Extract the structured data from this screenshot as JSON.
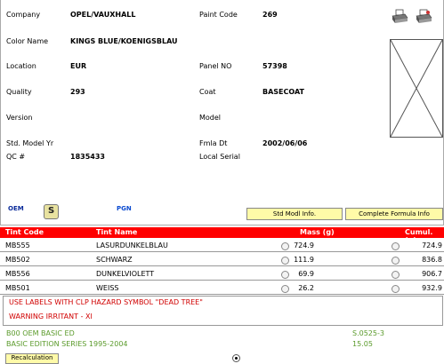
{
  "details": {
    "company_label": "Company",
    "company_value": "OPEL/VAUXHALL",
    "color_name_label": "Color Name",
    "color_name_value": "KINGS BLUE/KOENIGSBLAU",
    "location_label": "Location",
    "location_value": "EUR",
    "quality_label": "Quality",
    "quality_value": "293",
    "version_label": "Version",
    "version_value": "",
    "std_model_yr_label": "Std. Model Yr",
    "std_model_yr_value": "",
    "qc_label": "QC #",
    "qc_value": "1835433",
    "paint_code_label": "Paint Code",
    "paint_code_value": "269",
    "panel_no_label": "Panel NO",
    "panel_no_value": "57398",
    "coat_label": "Coat",
    "coat_value": "BASECOAT",
    "model_label": "Model",
    "model_value": "",
    "fmla_dt_label": "Fmla Dt",
    "fmla_dt_value": "2002/06/06",
    "local_serial_label": "Local Serial",
    "local_serial_value": ""
  },
  "icons": {
    "oem": "OEM",
    "s": "S",
    "pgn": "PGN"
  },
  "buttons": {
    "std_modl_info": "Std Modl Info.",
    "complete_formula_info": "Complete Formula Info",
    "recalculation": "Recalculation"
  },
  "table": {
    "headers": {
      "tint_code": "Tint Code",
      "tint_name": "Tint Name",
      "mass": "Mass (g)",
      "cumul": "Cumul. (g)"
    },
    "rows": [
      {
        "code": "MB555",
        "name": "LASURDUNKELBLAU",
        "mass": "724.9",
        "cumul": "724.9"
      },
      {
        "code": "MB502",
        "name": "SCHWARZ",
        "mass": "111.9",
        "cumul": "836.8"
      },
      {
        "code": "MB556",
        "name": "DUNKELVIOLETT",
        "mass": "69.9",
        "cumul": "906.7"
      },
      {
        "code": "MB501",
        "name": "WEISS",
        "mass": "26.2",
        "cumul": "932.9"
      }
    ]
  },
  "warnings": [
    "USE LABELS WITH CLP HAZARD SYMBOL \"DEAD TREE\"",
    "WARNING IRRITANT - XI"
  ],
  "footer": {
    "line1_left": "B00 OEM BASIC ED",
    "line1_right": "S.0525-3",
    "line2_left": "BASIC EDITION SERIES 1995-2004",
    "line2_right": "15.05"
  },
  "colors": {
    "table_header": "#ff0000",
    "warning_text": "#d00000",
    "footer_text": "#5a9a2a",
    "button_bg": "#fffaa8"
  }
}
